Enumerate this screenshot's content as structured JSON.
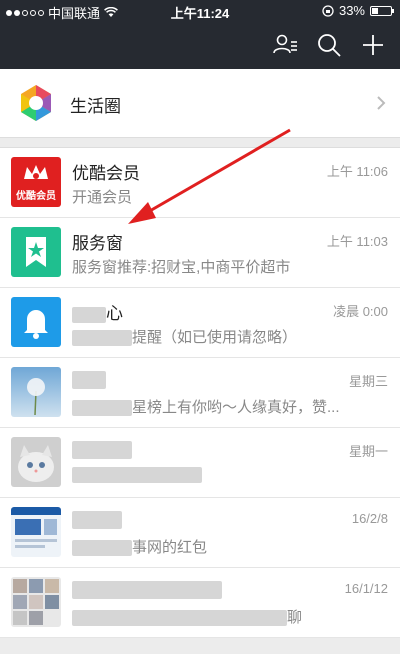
{
  "status_bar": {
    "carrier": "中国联通",
    "time": "上午11:24",
    "battery": "33%",
    "battery_level": 0.33
  },
  "nav": {
    "icons": [
      "contacts-icon",
      "search-icon",
      "add-icon"
    ]
  },
  "life_circle": {
    "label": "生活圈"
  },
  "messages": [
    {
      "name": "优酷会员",
      "time": "上午 11:06",
      "preview": "开通会员",
      "avatar_text": "优酷会员"
    },
    {
      "name": "服务窗",
      "time": "上午 11:03",
      "preview": "服务窗推荐:招财宝,中商平价超市"
    },
    {
      "name_visible": "心",
      "time": "凌晨 0:00",
      "preview_visible": "提醒（如已使用请忽略）"
    },
    {
      "time": "星期三",
      "preview_visible": "星榜上有你哟～人缘真好，赞..."
    },
    {
      "time": "星期一"
    },
    {
      "time": "16/2/8",
      "preview_visible": "事网的红包"
    },
    {
      "time": "16/1/12",
      "preview_visible": "聊"
    }
  ],
  "colors": {
    "topbar": "#262a31",
    "youku_red": "#e02020",
    "service_green": "#1fbf8f",
    "notice_blue": "#1e9be8",
    "arrow_red": "#e02020"
  }
}
